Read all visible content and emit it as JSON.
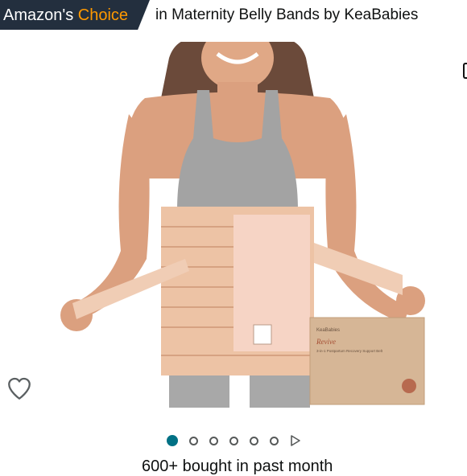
{
  "badge": {
    "prefix": "Amazon's",
    "highlight": "Choice"
  },
  "category_text": "in Maternity Belly Bands by KeaBabies",
  "product_box": {
    "brand": "KeaBabies",
    "product_name": "Revive",
    "subtitle": "3-in-1 Postpartum Recovery Support Belt"
  },
  "carousel": {
    "dots": [
      {
        "active": true
      },
      {
        "active": false
      },
      {
        "active": false
      },
      {
        "active": false
      },
      {
        "active": false
      },
      {
        "active": false
      }
    ],
    "next_icon": "play-arrow-icon"
  },
  "icons": {
    "wishlist": "heart-outline-icon"
  },
  "bought_text": "600+ bought in past month",
  "colors": {
    "badge_bg": "#232f3e",
    "badge_highlight": "#ff9900",
    "active_dot": "#007185"
  }
}
